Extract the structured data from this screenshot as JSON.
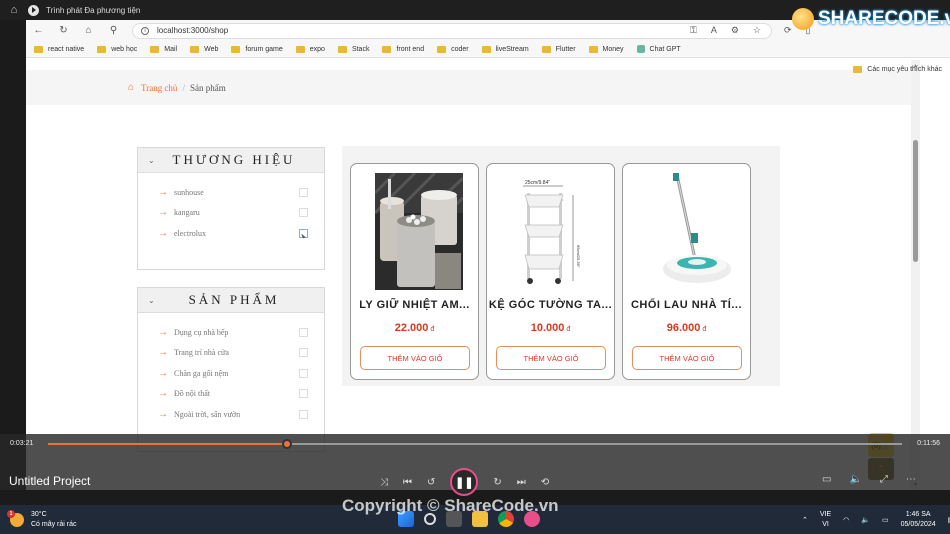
{
  "window": {
    "title": "Trình phát Đa phương tiện"
  },
  "browser": {
    "url": "localhost:3000/shop",
    "bookmarks": [
      "react native",
      "web học",
      "Mail",
      "Web",
      "forum game",
      "expo",
      "Stack",
      "front end",
      "coder",
      "liveStream",
      "Flutter",
      "Money",
      "Chat GPT"
    ],
    "bookmarks_other": "Các mục yêu thích khác"
  },
  "breadcrumb": {
    "home": "Trang chủ",
    "separator": "/",
    "current": "Sản phẩm"
  },
  "brand_filter": {
    "title": "THƯƠNG HIỆU",
    "items": [
      "sunhouse",
      "kangaru",
      "electrolux"
    ]
  },
  "product_filter": {
    "title": "SẢN PHẨM",
    "items": [
      "Dụng cụ nhà bếp",
      "Trang trí nhà cửa",
      "Chăn ga gối nệm",
      "Đồ nội thất",
      "Ngoài trời, sân vườn"
    ]
  },
  "products": [
    {
      "name": "LY GIỮ NHIỆT AM...",
      "price": "22.000",
      "currency": "đ",
      "button": "THÊM VÀO GIỎ"
    },
    {
      "name": "KỆ GÓC TƯỜNG TA...",
      "price": "10.000",
      "currency": "đ",
      "button": "THÊM VÀO GIỎ"
    },
    {
      "name": "CHỔI LAU NHÀ TÍ...",
      "price": "96.000",
      "currency": "đ",
      "button": "THÊM VÀO GIỎ"
    }
  ],
  "product_images": {
    "img2_label_top": "25cm/9.84\"",
    "img2_label_mid": "23cm/12.60\"",
    "img2_label_side": "65cm/25.59\""
  },
  "cart_float": {
    "label": "(0)🛒"
  },
  "player": {
    "time_elapsed": "0:03:21",
    "time_total": "0:11:56",
    "progress": 0.28,
    "project": "Untitled Project"
  },
  "taskbar": {
    "temperature": "30°C",
    "weather": "Có mây rải rác",
    "weather_badge": "1",
    "lang1": "VIE",
    "lang2": "VI",
    "time": "1:46 SA",
    "date": "05/05/2024"
  },
  "watermarks": {
    "top": "SHARECODE.vn",
    "middle": "ShareCode.vn",
    "bottom": "Copyright © ShareCode.vn"
  },
  "colors": {
    "accent": "#e8743b",
    "price": "#d9391d",
    "cart": "#f5d117"
  }
}
